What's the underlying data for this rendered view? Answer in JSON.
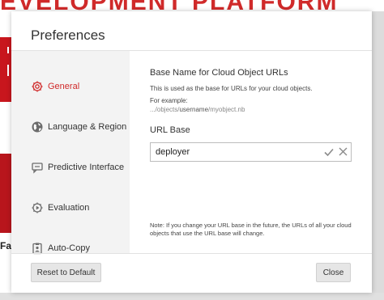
{
  "background": {
    "banner_text": "EVELOPMENT PLATFORM",
    "side_fragment": "Fa"
  },
  "dialog": {
    "title": "Preferences"
  },
  "sidebar": {
    "items": [
      {
        "label": "General",
        "icon": "gear-icon",
        "active": true
      },
      {
        "label": "Language & Region",
        "icon": "globe-icon",
        "active": false
      },
      {
        "label": "Predictive Interface",
        "icon": "chat-icon",
        "active": false
      },
      {
        "label": "Evaluation",
        "icon": "evaluation-gear-icon",
        "active": false
      },
      {
        "label": "Auto-Copy",
        "icon": "clipboard-icon",
        "active": false
      }
    ]
  },
  "general": {
    "heading": "Base Name for Cloud Object URLs",
    "description": "This is used as the base for URLs for your cloud objects.",
    "example_label": "For example:",
    "example_prefix": ".../objects/",
    "example_user": "username",
    "example_suffix": "/myobject.nb",
    "url_base_label": "URL Base",
    "url_base_value": "deployer",
    "note": "Note: If you change your URL base in the future, the URLs of all your cloud objects that use the URL base will change."
  },
  "footer": {
    "reset_label": "Reset to Default",
    "close_label": "Close"
  },
  "colors": {
    "accent": "#d02a2a",
    "ok_check": "#8a8a8a"
  }
}
